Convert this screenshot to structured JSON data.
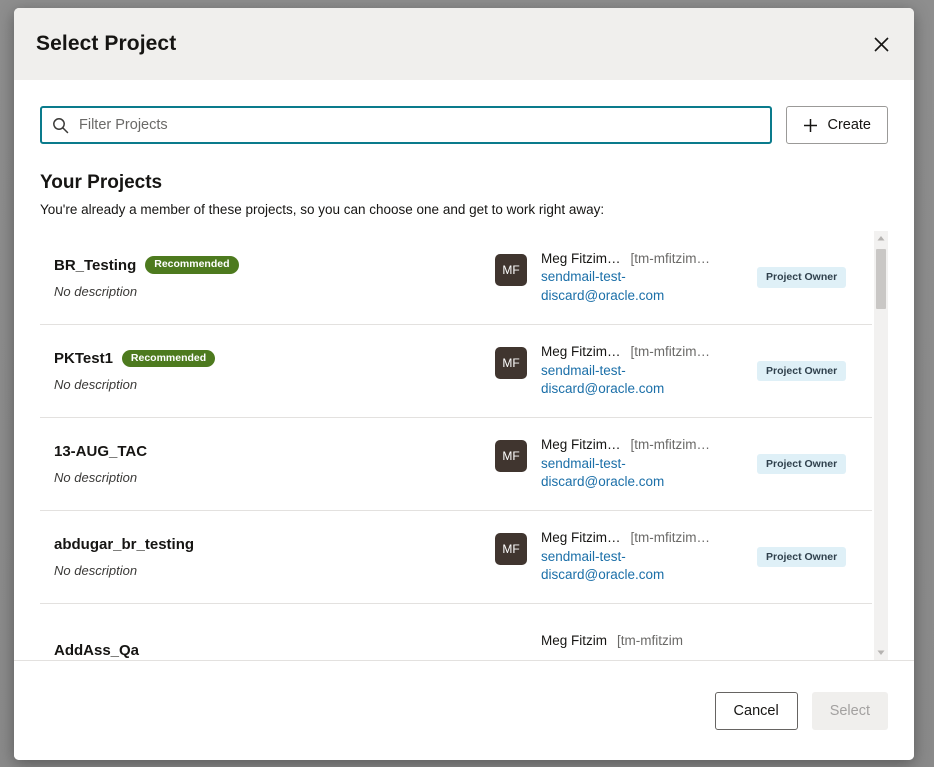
{
  "dialog": {
    "title": "Select Project",
    "close_label": "✕"
  },
  "search": {
    "placeholder": "Filter Projects",
    "value": "",
    "icon": "search-icon"
  },
  "create_button": {
    "label": "Create",
    "icon": "plus-icon"
  },
  "section": {
    "heading": "Your Projects",
    "subheading": "You're already a member of these projects, so you can choose one and get to work right away:"
  },
  "projects": [
    {
      "name": "BR_Testing",
      "badge": "Recommended",
      "description": "No description",
      "avatar_initials": "MF",
      "owner_name": "Meg Fitzim…",
      "owner_handle": "[tm-mfitzim…",
      "owner_email": "sendmail-test-discard@oracle.com",
      "role": "Project Owner"
    },
    {
      "name": "PKTest1",
      "badge": "Recommended",
      "description": "No description",
      "avatar_initials": "MF",
      "owner_name": "Meg Fitzim…",
      "owner_handle": "[tm-mfitzim…",
      "owner_email": "sendmail-test-discard@oracle.com",
      "role": "Project Owner"
    },
    {
      "name": "13-AUG_TAC",
      "badge": "",
      "description": "No description",
      "avatar_initials": "MF",
      "owner_name": "Meg Fitzim…",
      "owner_handle": "[tm-mfitzim…",
      "owner_email": "sendmail-test-discard@oracle.com",
      "role": "Project Owner"
    },
    {
      "name": "abdugar_br_testing",
      "badge": "",
      "description": "No description",
      "avatar_initials": "MF",
      "owner_name": "Meg Fitzim…",
      "owner_handle": "[tm-mfitzim…",
      "owner_email": "sendmail-test-discard@oracle.com",
      "role": "Project Owner"
    },
    {
      "name": "AddAss_Qa",
      "badge": "",
      "description": "",
      "avatar_initials": "",
      "owner_name": "Meg Fitzim",
      "owner_handle": "[tm-mfitzim",
      "owner_email": "",
      "role": ""
    }
  ],
  "footer": {
    "cancel_label": "Cancel",
    "select_label": "Select"
  },
  "colors": {
    "accent_border": "#0a7b8c",
    "link": "#1b6fa8",
    "badge_recommended_bg": "#4d7a1e",
    "badge_role_bg": "#dff0f7",
    "avatar_bg": "#40352f",
    "header_bg": "#f0efed"
  }
}
